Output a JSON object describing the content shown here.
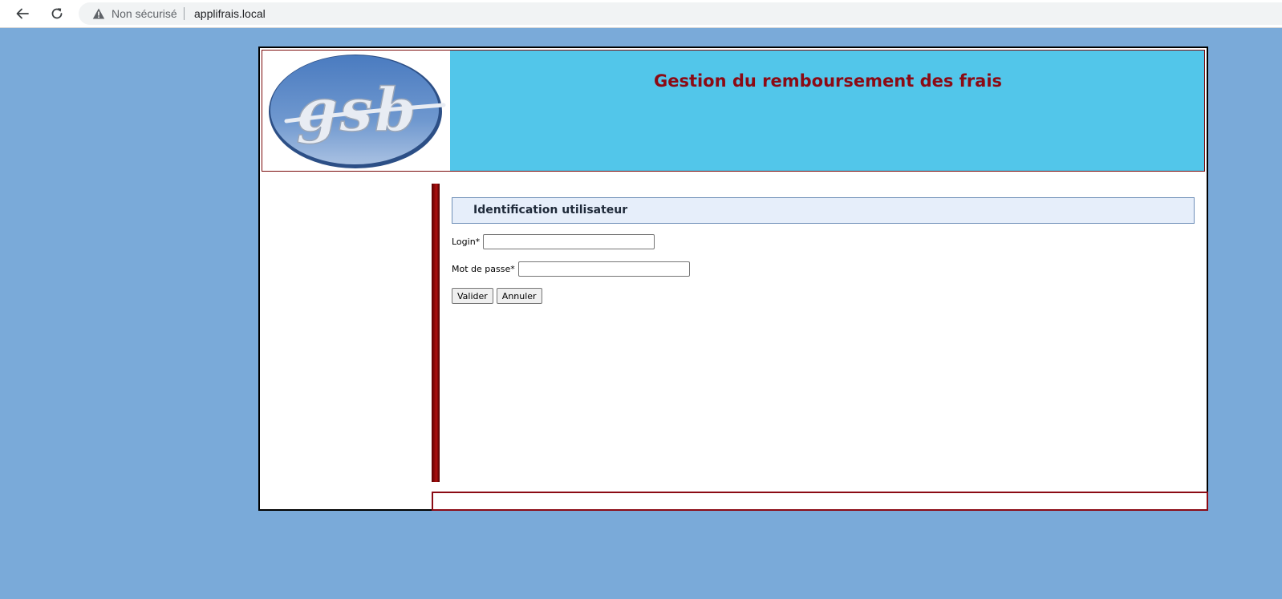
{
  "browser": {
    "security_label": "Non sécurisé",
    "url": "applifrais.local"
  },
  "header": {
    "logo_text": "gsb",
    "title": "Gestion du remboursement des frais"
  },
  "login_form": {
    "heading": "Identification utilisateur",
    "login_label": "Login*",
    "login_value": "",
    "password_label": "Mot de passe*",
    "password_value": "",
    "submit_label": "Valider",
    "reset_label": "Annuler"
  },
  "colors": {
    "page_background": "#7aaad9",
    "header_background": "#52c6ea",
    "title_color": "#8b0a14",
    "accent_bar": "#8b0a14",
    "heading_background": "#e6eefa"
  },
  "icons": {
    "back": "arrow-left-icon",
    "reload": "reload-icon",
    "security": "warning-triangle-icon"
  }
}
